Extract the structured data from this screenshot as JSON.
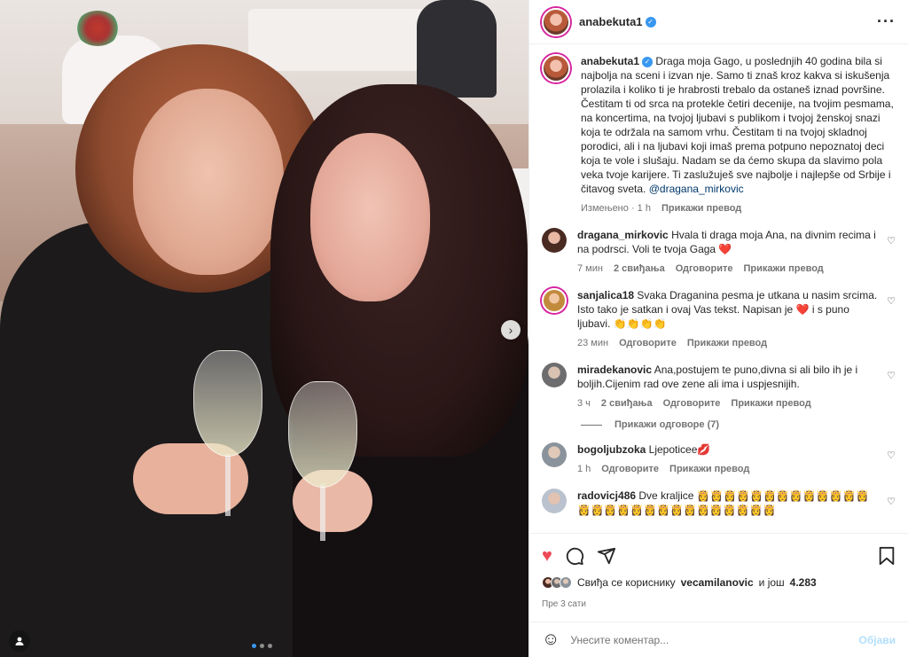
{
  "post": {
    "username": "anabekuta1",
    "caption": "Draga moja Gago, u poslednjih 40 godina bila si najbolja na sceni i izvan nje. Samo ti znaš kroz kakva si iskušenja prolazila i koliko ti je hrabrosti trebalo da ostaneš iznad površine. Čestitam ti od srca na protekle četiri decenije, na tvojim pesmama, na koncertima, na tvojoj ljubavi s publikom i tvojoj ženskoj snazi koja te održala na samom vrhu. Čestitam ti na tvojoj skladnoj porodici, ali i na ljubavi koji imaš prema potpuno nepoznatoj deci koja te vole i slušaju. Nadam se da ćemo skupa da slavimo pola veka tvoje karijere. Ti zaslužuješ sve najbolje i najlepše od Srbije i čitavog sveta.",
    "mention": "@dragana_mirkovic",
    "edited": "Измењено",
    "time": "1 h",
    "translate": "Прикажи превод"
  },
  "comments": [
    {
      "user": "dragana_mirkovic",
      "text": "Hvala ti draga moja Ana, na divnim recima i na podrsci. Voli te tvoja Gaga ❤️",
      "time": "7 мин",
      "likes": "2 свиђања",
      "reply": "Одговорите",
      "translate": "Прикажи превод"
    },
    {
      "user": "sanjalica18",
      "text": "Svaka Draganina pesma je utkana u nasim srcima. Isto tako je satkan i ovaj Vas tekst. Napisan je ❤️ i s puno ljubavi. 👏👏👏👏",
      "time": "23 мин",
      "reply": "Одговорите",
      "translate": "Прикажи превод"
    },
    {
      "user": "miradekanovic",
      "text": "Ana,postujem te puno,divna si ali bilo ih je i boljih.Cijenim rad ove zene ali ima i uspjesnijih.",
      "time": "3 ч",
      "likes": "2 свиђања",
      "reply": "Одговорите",
      "translate": "Прикажи превод",
      "view_replies": "Прикажи одговоре (7)"
    },
    {
      "user": "bogoljubzoka",
      "text": "Ljepoticee💋",
      "time": "1 h",
      "reply": "Одговорите",
      "translate": "Прикажи превод"
    },
    {
      "user": "radovicj486",
      "text": "Dve kraljice 👸👸👸👸👸👸👸👸👸👸👸👸👸👸👸👸👸👸👸👸👸👸👸👸👸👸👸👸"
    }
  ],
  "footer": {
    "likes_prefix": "Свиђа се кориснику",
    "likes_user": "vecamilanovic",
    "likes_mid": "и још",
    "likes_count": "4.283",
    "posted_time": "Пре 3 сати",
    "comment_placeholder": "Унесите коментар...",
    "post_label": "Објави"
  },
  "colors": {
    "accent": "#3897f0",
    "like": "#ed4956"
  }
}
